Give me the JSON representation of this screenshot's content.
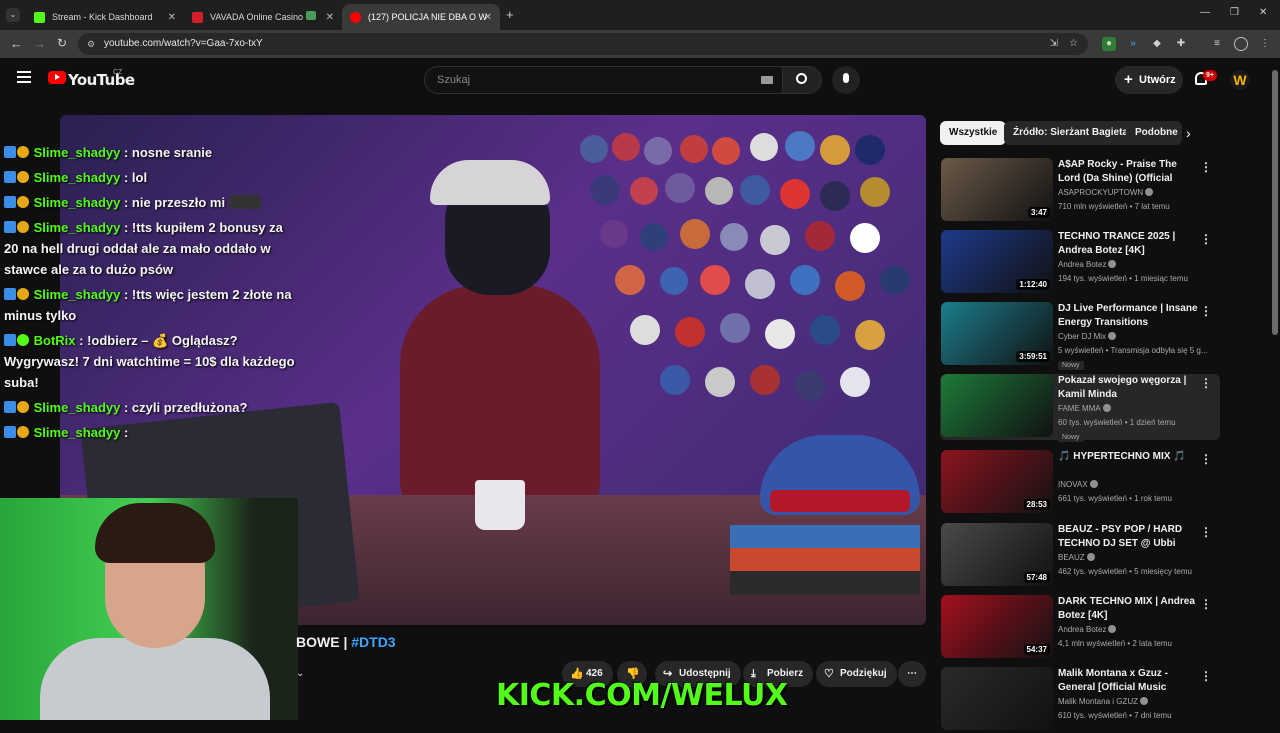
{
  "tabs": [
    {
      "title": "Stream - Kick Dashboard",
      "color": "#53fc18",
      "active": false
    },
    {
      "title": "VAVADA Online Casino",
      "color": "#d01e2b",
      "active": false
    },
    {
      "title": "(127) POLICJA NIE DBA O W",
      "color": "#ff0000",
      "active": true
    }
  ],
  "address": {
    "url": "youtube.com/watch?v=Gaa-7xo-txY"
  },
  "yt": {
    "logo": "YouTube",
    "country": "CZ",
    "search_placeholder": "Szukaj",
    "create_label": "Utwórz",
    "notif_count": "9+"
  },
  "chat": [
    {
      "user": "Slime_shadyy",
      "text": ": nosne sranie",
      "badges": [
        "blue",
        "gold"
      ]
    },
    {
      "user": "Slime_shadyy",
      "text": ": lol",
      "badges": [
        "blue",
        "gold"
      ]
    },
    {
      "user": "Slime_shadyy",
      "text": ": nie przeszło mi",
      "badges": [
        "blue",
        "gold"
      ]
    },
    {
      "user": "Slime_shadyy",
      "text": ": !tts kupiłem 2 bonusy za 20 na hell drugi oddał ale za mało oddało w stawce ale za to dużo psów",
      "badges": [
        "blue",
        "gold"
      ]
    },
    {
      "user": "Slime_shadyy",
      "text": ": !tts więc jestem 2 złote na minus tylko",
      "badges": [
        "blue",
        "gold"
      ]
    },
    {
      "user": "BotRix",
      "text": ": !odbierz – 💰 Oglądasz? Wygrywasz! 7 dni watchtime = 10$ dla każdego suba!",
      "badges": [
        "blue",
        "green"
      ]
    },
    {
      "user": "Slime_shadyy",
      "text": ": czyli przedłużona?",
      "badges": [
        "blue",
        "gold"
      ]
    },
    {
      "user": "Slime_shadyy",
      "text": ":",
      "badges": [
        "blue",
        "gold"
      ]
    }
  ],
  "video": {
    "title_partial": "BOWE | ",
    "hashtag": "#DTD3",
    "likes": "426",
    "share": "Udostępnij",
    "download": "Pobierz",
    "thanks": "Podziękuj"
  },
  "overlay": {
    "kick_url": "KICK.COM/WELUX"
  },
  "chips": [
    "Wszystkie",
    "Źródło: Sierżant Bagieta",
    "Podobne"
  ],
  "recommended": [
    {
      "title": "A$AP Rocky - Praise The Lord (Da Shine) (Official Video) ft. ...",
      "channel": "ASAPROCKYUPTOWN",
      "meta": "710 mln wyświetleń • 7 lat temu",
      "duration": "3:47",
      "thumb": "#6b5a48",
      "new": ""
    },
    {
      "title": "TECHNO TRANCE 2025 | Andrea Botez [4K]",
      "channel": "Andrea Botez",
      "meta": "194 tys. wyświetleń • 1 miesiąc temu",
      "duration": "1:12:40",
      "thumb": "#1e3a8a",
      "new": ""
    },
    {
      "title": "DJ Live Performance | Insane Energy Transitions",
      "channel": "Cyber DJ Mix",
      "meta": "5 wyświetleń • Transmisja odbyła się 5 g...",
      "duration": "3:59:51",
      "thumb": "#1b7d8c",
      "new": "Nowy"
    },
    {
      "title": "Pokazał swojego węgorza | Kamil Minda",
      "channel": "FAME MMA",
      "meta": "60 tys. wyświetleń • 1 dzień temu",
      "duration": "",
      "thumb": "#1d7a3a",
      "new": "Nowy"
    },
    {
      "title": "🎵 HYPERTECHNO MIX 🎵",
      "channel": "INOVAX",
      "meta": "661 tys. wyświetleń • 1 rok temu",
      "duration": "28:53",
      "thumb": "#8c1420",
      "new": ""
    },
    {
      "title": "BEAUZ - PSY POP / HARD TECHNO DJ SET @ Ubbi Dubbi...",
      "channel": "BEAUZ",
      "meta": "462 tys. wyświetleń • 5 miesięcy temu",
      "duration": "57:48",
      "thumb": "#4a4a4a",
      "new": ""
    },
    {
      "title": "DARK TECHNO MIX | Andrea Botez [4K]",
      "channel": "Andrea Botez",
      "meta": "4,1 mln wyświetleń • 2 lata temu",
      "duration": "54:37",
      "thumb": "#a3101e",
      "new": ""
    },
    {
      "title": "Malik Montana x Gzuz - General [Official Music Video]",
      "channel": "Malik Montana i GZUZ",
      "meta": "610 tys. wyświetleń • 7 dni temu",
      "duration": "",
      "thumb": "#2a2a2a",
      "new": ""
    }
  ]
}
